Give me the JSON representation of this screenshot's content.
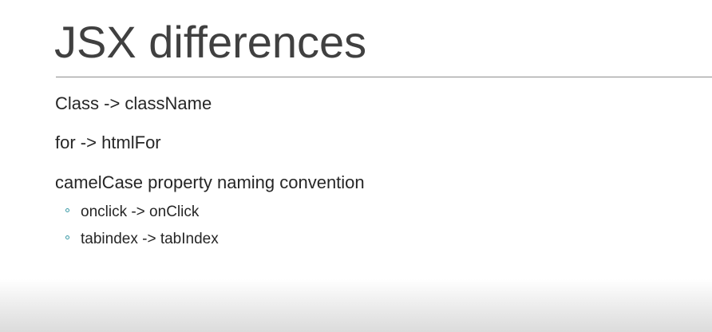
{
  "slide": {
    "title": "JSX differences",
    "items": [
      {
        "text": "Class -> className"
      },
      {
        "text": "for -> htmlFor"
      },
      {
        "text": "camelCase property naming convention",
        "subitems": [
          {
            "text": "onclick -> onClick"
          },
          {
            "text": "tabindex -> tabIndex"
          }
        ]
      }
    ],
    "colors": {
      "title": "#404040",
      "body": "#262626",
      "accent_marker": "#3a9aa6",
      "rule": "#8c8c8c"
    }
  }
}
